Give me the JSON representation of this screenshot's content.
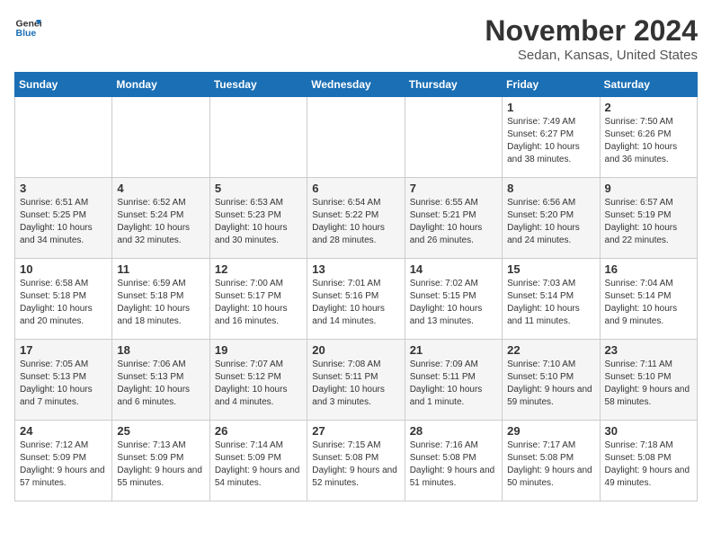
{
  "header": {
    "logo_line1": "General",
    "logo_line2": "Blue",
    "title": "November 2024",
    "subtitle": "Sedan, Kansas, United States"
  },
  "days_of_week": [
    "Sunday",
    "Monday",
    "Tuesday",
    "Wednesday",
    "Thursday",
    "Friday",
    "Saturday"
  ],
  "weeks": [
    [
      {
        "day": "",
        "info": ""
      },
      {
        "day": "",
        "info": ""
      },
      {
        "day": "",
        "info": ""
      },
      {
        "day": "",
        "info": ""
      },
      {
        "day": "",
        "info": ""
      },
      {
        "day": "1",
        "info": "Sunrise: 7:49 AM\nSunset: 6:27 PM\nDaylight: 10 hours and 38 minutes."
      },
      {
        "day": "2",
        "info": "Sunrise: 7:50 AM\nSunset: 6:26 PM\nDaylight: 10 hours and 36 minutes."
      }
    ],
    [
      {
        "day": "3",
        "info": "Sunrise: 6:51 AM\nSunset: 5:25 PM\nDaylight: 10 hours and 34 minutes."
      },
      {
        "day": "4",
        "info": "Sunrise: 6:52 AM\nSunset: 5:24 PM\nDaylight: 10 hours and 32 minutes."
      },
      {
        "day": "5",
        "info": "Sunrise: 6:53 AM\nSunset: 5:23 PM\nDaylight: 10 hours and 30 minutes."
      },
      {
        "day": "6",
        "info": "Sunrise: 6:54 AM\nSunset: 5:22 PM\nDaylight: 10 hours and 28 minutes."
      },
      {
        "day": "7",
        "info": "Sunrise: 6:55 AM\nSunset: 5:21 PM\nDaylight: 10 hours and 26 minutes."
      },
      {
        "day": "8",
        "info": "Sunrise: 6:56 AM\nSunset: 5:20 PM\nDaylight: 10 hours and 24 minutes."
      },
      {
        "day": "9",
        "info": "Sunrise: 6:57 AM\nSunset: 5:19 PM\nDaylight: 10 hours and 22 minutes."
      }
    ],
    [
      {
        "day": "10",
        "info": "Sunrise: 6:58 AM\nSunset: 5:18 PM\nDaylight: 10 hours and 20 minutes."
      },
      {
        "day": "11",
        "info": "Sunrise: 6:59 AM\nSunset: 5:18 PM\nDaylight: 10 hours and 18 minutes."
      },
      {
        "day": "12",
        "info": "Sunrise: 7:00 AM\nSunset: 5:17 PM\nDaylight: 10 hours and 16 minutes."
      },
      {
        "day": "13",
        "info": "Sunrise: 7:01 AM\nSunset: 5:16 PM\nDaylight: 10 hours and 14 minutes."
      },
      {
        "day": "14",
        "info": "Sunrise: 7:02 AM\nSunset: 5:15 PM\nDaylight: 10 hours and 13 minutes."
      },
      {
        "day": "15",
        "info": "Sunrise: 7:03 AM\nSunset: 5:14 PM\nDaylight: 10 hours and 11 minutes."
      },
      {
        "day": "16",
        "info": "Sunrise: 7:04 AM\nSunset: 5:14 PM\nDaylight: 10 hours and 9 minutes."
      }
    ],
    [
      {
        "day": "17",
        "info": "Sunrise: 7:05 AM\nSunset: 5:13 PM\nDaylight: 10 hours and 7 minutes."
      },
      {
        "day": "18",
        "info": "Sunrise: 7:06 AM\nSunset: 5:13 PM\nDaylight: 10 hours and 6 minutes."
      },
      {
        "day": "19",
        "info": "Sunrise: 7:07 AM\nSunset: 5:12 PM\nDaylight: 10 hours and 4 minutes."
      },
      {
        "day": "20",
        "info": "Sunrise: 7:08 AM\nSunset: 5:11 PM\nDaylight: 10 hours and 3 minutes."
      },
      {
        "day": "21",
        "info": "Sunrise: 7:09 AM\nSunset: 5:11 PM\nDaylight: 10 hours and 1 minute."
      },
      {
        "day": "22",
        "info": "Sunrise: 7:10 AM\nSunset: 5:10 PM\nDaylight: 9 hours and 59 minutes."
      },
      {
        "day": "23",
        "info": "Sunrise: 7:11 AM\nSunset: 5:10 PM\nDaylight: 9 hours and 58 minutes."
      }
    ],
    [
      {
        "day": "24",
        "info": "Sunrise: 7:12 AM\nSunset: 5:09 PM\nDaylight: 9 hours and 57 minutes."
      },
      {
        "day": "25",
        "info": "Sunrise: 7:13 AM\nSunset: 5:09 PM\nDaylight: 9 hours and 55 minutes."
      },
      {
        "day": "26",
        "info": "Sunrise: 7:14 AM\nSunset: 5:09 PM\nDaylight: 9 hours and 54 minutes."
      },
      {
        "day": "27",
        "info": "Sunrise: 7:15 AM\nSunset: 5:08 PM\nDaylight: 9 hours and 52 minutes."
      },
      {
        "day": "28",
        "info": "Sunrise: 7:16 AM\nSunset: 5:08 PM\nDaylight: 9 hours and 51 minutes."
      },
      {
        "day": "29",
        "info": "Sunrise: 7:17 AM\nSunset: 5:08 PM\nDaylight: 9 hours and 50 minutes."
      },
      {
        "day": "30",
        "info": "Sunrise: 7:18 AM\nSunset: 5:08 PM\nDaylight: 9 hours and 49 minutes."
      }
    ]
  ]
}
